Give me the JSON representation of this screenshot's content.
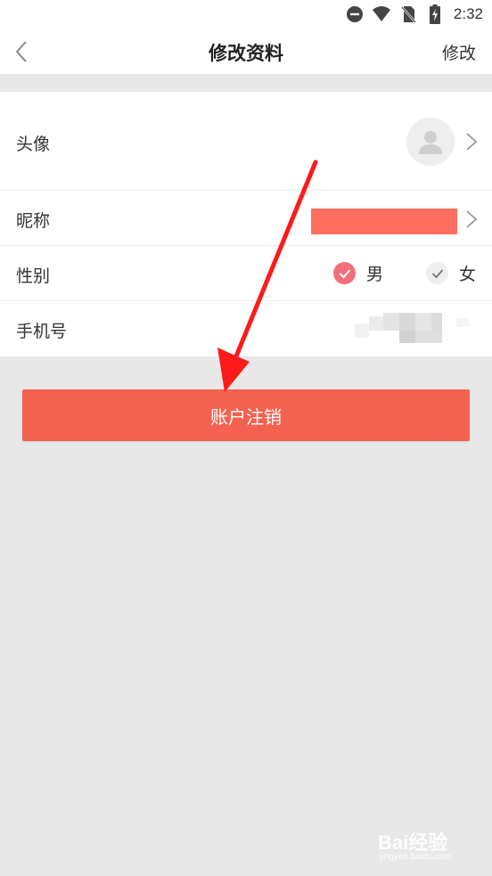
{
  "status_bar": {
    "time": "2:32",
    "icons": [
      "do-not-disturb-icon",
      "wifi-icon",
      "no-sim-icon",
      "battery-charging-icon"
    ]
  },
  "nav": {
    "title": "修改资料",
    "action_label": "修改",
    "back_icon": "chevron-left-icon"
  },
  "profile": {
    "avatar": {
      "label": "头像",
      "icon": "default-user-avatar-icon"
    },
    "nickname": {
      "label": "昵称",
      "value_redacted": true,
      "redaction_color": "#ff6f60"
    },
    "gender": {
      "label": "性别",
      "options": [
        {
          "label": "男",
          "selected": true
        },
        {
          "label": "女",
          "selected": false
        }
      ],
      "selected_color": "#f2707a"
    },
    "phone": {
      "label": "手机号",
      "value_redacted": true
    }
  },
  "cancel_account_button": {
    "label": "账户注销",
    "color": "#f36251"
  },
  "annotation": {
    "type": "red-arrow-pointing-to-button",
    "color": "#ff1a1a"
  },
  "watermark": {
    "brand": "Bai经验",
    "url": "jingyan.baidu.com"
  },
  "colors": {
    "background": "#e8e8e8",
    "surface": "#ffffff",
    "accent": "#f36251"
  }
}
